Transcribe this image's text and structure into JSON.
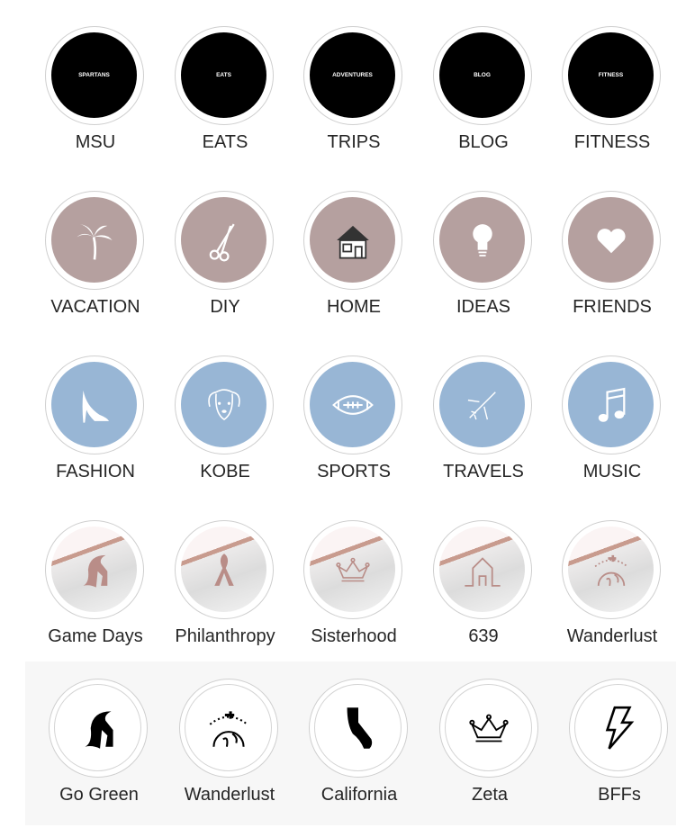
{
  "rows": [
    [
      {
        "label": "MSU",
        "cover": "SPARTANS"
      },
      {
        "label": "EATS",
        "cover": "EATS"
      },
      {
        "label": "TRIPS",
        "cover": "ADVENTURES"
      },
      {
        "label": "BLOG",
        "cover": "BLOG"
      },
      {
        "label": "FITNESS",
        "cover": "FITNESS"
      }
    ],
    [
      {
        "label": "VACATION",
        "icon": "palm-tree-icon"
      },
      {
        "label": "DIY",
        "icon": "scissors-icon"
      },
      {
        "label": "HOME",
        "icon": "house-icon"
      },
      {
        "label": "IDEAS",
        "icon": "lightbulb-icon"
      },
      {
        "label": "FRIENDS",
        "icon": "heart-icon"
      }
    ],
    [
      {
        "label": "FASHION",
        "icon": "high-heel-icon"
      },
      {
        "label": "KOBE",
        "icon": "dog-icon"
      },
      {
        "label": "SPORTS",
        "icon": "football-icon"
      },
      {
        "label": "TRAVELS",
        "icon": "airplane-icon"
      },
      {
        "label": "MUSIC",
        "icon": "music-note-icon"
      }
    ],
    [
      {
        "label": "Game Days",
        "icon": "spartan-helmet-icon"
      },
      {
        "label": "Philanthropy",
        "icon": "ribbon-icon"
      },
      {
        "label": "Sisterhood",
        "icon": "crown-icon"
      },
      {
        "label": "639",
        "icon": "house-outline-icon"
      },
      {
        "label": "Wanderlust",
        "icon": "globe-plane-icon"
      }
    ],
    [
      {
        "label": "Go Green",
        "icon": "spartan-helmet-icon"
      },
      {
        "label": "Wanderlust",
        "icon": "globe-plane-icon"
      },
      {
        "label": "California",
        "icon": "california-icon"
      },
      {
        "label": "Zeta",
        "icon": "crown-icon"
      },
      {
        "label": "BFFs",
        "icon": "lightning-icon"
      }
    ]
  ],
  "colors": {
    "black": "#000000",
    "mauve": "#b5a09f",
    "blue": "#98b6d5",
    "rose": "#b98d88",
    "tray": "#f7f7f7"
  }
}
